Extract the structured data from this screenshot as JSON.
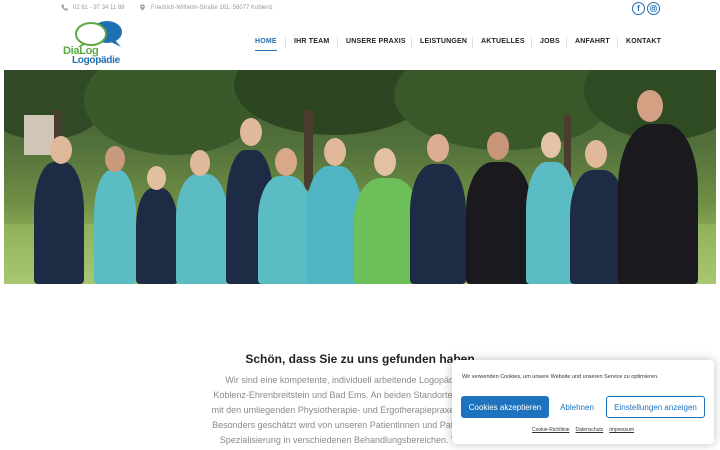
{
  "topbar": {
    "phone": "02 61 - 97 34 11 88",
    "address": "Friedrich-Wilhelm-Straße 161, 56077 Koblenz",
    "facebook_glyph": "f"
  },
  "logo": {
    "line1": "DiaLog",
    "line2": "Logopädie"
  },
  "nav": {
    "items": [
      "HOME",
      "IHR TEAM",
      "UNSERE PRAXIS",
      "LEISTUNGEN",
      "AKTUELLES",
      "JOBS",
      "ANFAHRT",
      "KONTAKT"
    ],
    "active": "HOME"
  },
  "intro": {
    "title": "Schön, dass Sie zu uns gefunden haben",
    "text": "Wir sind eine kompetente, individuell arbeitende Logopädiepraxis in Koblenz-Ehrenbreitstein und Bad Ems. An beiden Standorten arbeiten wir mit den umliegenden Physiotherapie- und Ergotherapiepraxen zusammen. Besonders geschätzt wird von unseren Patientinnen und Patienten unsere Spezialisierung in verschiedenen Behandlungsbereichen. Wir beraten, untersuchen und"
  },
  "cookie": {
    "message": "Wir verwenden Cookies, um unsere Website und unseren Service zu optimieren.",
    "accept_label": "Cookies akzeptieren",
    "deny_label": "Ablehnen",
    "settings_label": "Einstellungen anzeigen",
    "links": [
      "Cookie-Richtlinie",
      "Datenschutz",
      "Impressum"
    ]
  },
  "colors": {
    "brand_blue": "#1f6fb2",
    "brand_green": "#5aa842",
    "cookie_blue": "#1e73be"
  },
  "icons": {
    "phone": "phone-icon",
    "address": "map-pin-icon",
    "facebook": "facebook-icon",
    "instagram": "instagram-icon"
  }
}
